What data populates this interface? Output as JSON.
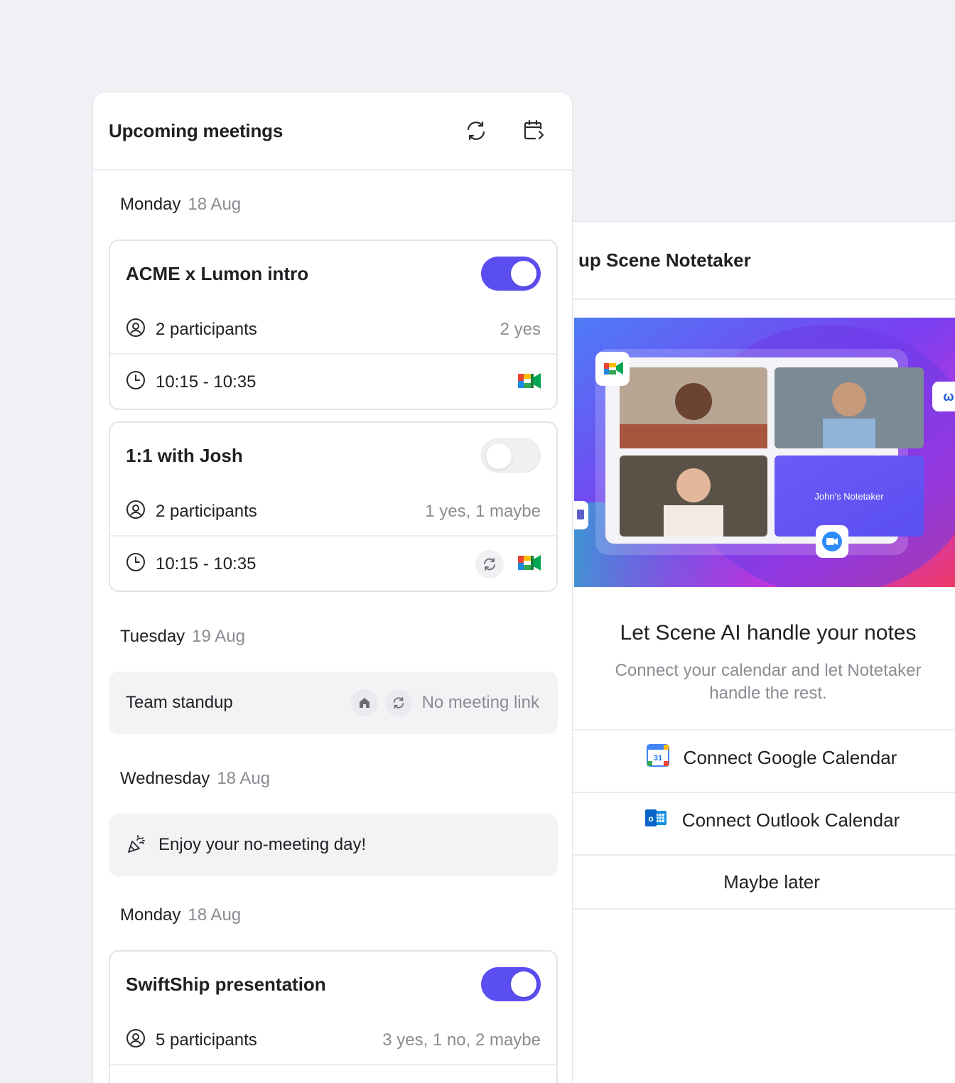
{
  "meetings_panel": {
    "title": "Upcoming meetings",
    "icons": [
      "refresh-icon",
      "calendar-export-icon"
    ],
    "days": [
      {
        "day": "Monday",
        "date": "18 Aug",
        "meetings": [
          {
            "title": "ACME x Lumon intro",
            "enabled": true,
            "participants": "2 participants",
            "rsvp": "2 yes",
            "time": "10:15 - 10:35",
            "recurring": false,
            "platform": "google-meet-icon"
          },
          {
            "title": "1:1 with Josh",
            "enabled": false,
            "participants": "2 participants",
            "rsvp": "1 yes, 1 maybe",
            "time": "10:15 - 10:35",
            "recurring": true,
            "platform": "google-meet-icon"
          }
        ]
      },
      {
        "day": "Tuesday",
        "date": "19 Aug",
        "no_link_meeting": {
          "title": "Team standup",
          "status": "No meeting link"
        }
      },
      {
        "day": "Wednesday",
        "date": "18 Aug",
        "empty_message": "Enjoy your no-meeting day!"
      },
      {
        "day": "Monday",
        "date": "18 Aug",
        "meetings": [
          {
            "title": "SwiftShip presentation",
            "enabled": true,
            "participants": "5 participants",
            "rsvp": "3 yes, 1 no, 2 maybe"
          }
        ]
      }
    ]
  },
  "notetaker_panel": {
    "title": "up Scene Notetaker",
    "hero": {
      "tile_label": "John's Notetaker"
    },
    "heading": "Let Scene AI handle your notes",
    "subtitle": "Connect your calendar and let Notetaker handle the rest.",
    "buttons": {
      "google": "Connect Google Calendar",
      "outlook": "Connect Outlook Calendar",
      "later": "Maybe later"
    }
  },
  "colors": {
    "accent": "#5b4ef0",
    "background": "#f1f1f5",
    "muted_text": "#8b8b93"
  }
}
